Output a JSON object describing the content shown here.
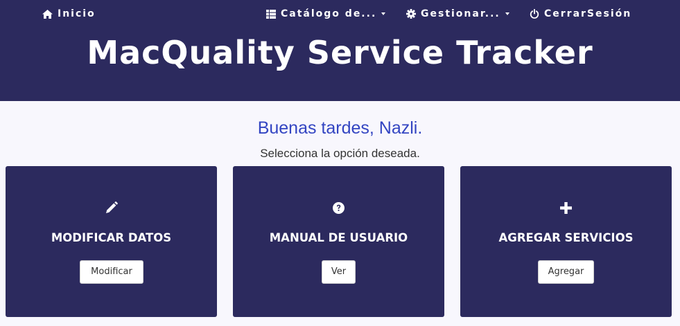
{
  "nav": {
    "home": {
      "label": "Inicio",
      "icon": "home-icon"
    },
    "catalog": {
      "label": "Catálogo de...",
      "icon": "table-icon"
    },
    "manage": {
      "label": "Gestionar...",
      "icon": "gear-icon"
    },
    "logout": {
      "label": "CerrarSesión",
      "icon": "power-icon"
    }
  },
  "header": {
    "title": "MacQuality Service Tracker"
  },
  "main": {
    "greeting": "Buenas tardes, Nazli.",
    "subtitle": "Selecciona la opción deseada."
  },
  "cards": [
    {
      "icon": "pencil-icon",
      "title": "MODIFICAR DATOS",
      "button": "Modificar"
    },
    {
      "icon": "question-circle-icon",
      "title": "MANUAL DE USUARIO",
      "button": "Ver"
    },
    {
      "icon": "plus-icon",
      "title": "AGREGAR SERVICIOS",
      "button": "Agregar"
    }
  ],
  "colors": {
    "header_bg": "#2c2a5e",
    "card_bg": "#2c2a5e",
    "page_bg": "#f8f7fd",
    "greeting": "#3345c2"
  }
}
